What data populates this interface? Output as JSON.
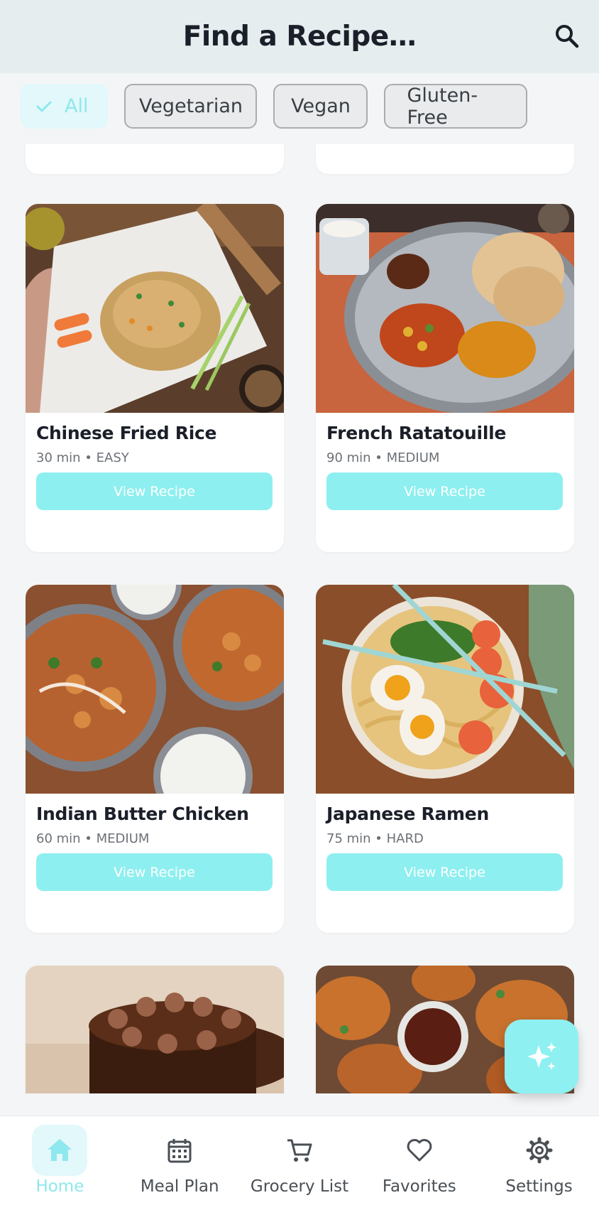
{
  "header": {
    "title": "Find a Recipe…"
  },
  "filters": [
    {
      "label": "All",
      "active": true
    },
    {
      "label": "Vegetarian",
      "active": false
    },
    {
      "label": "Vegan",
      "active": false
    },
    {
      "label": "Gluten-Free",
      "active": false
    }
  ],
  "recipes": [
    {
      "title": "Chinese Fried Rice",
      "meta": "30 min • EASY",
      "button": "View Recipe",
      "image": "fried-rice-image"
    },
    {
      "title": "French Ratatouille",
      "meta": "90 min • MEDIUM",
      "button": "View Recipe",
      "image": "thali-plate-image"
    },
    {
      "title": "Indian Butter Chicken",
      "meta": "60 min • MEDIUM",
      "button": "View Recipe",
      "image": "butter-chicken-image"
    },
    {
      "title": "Japanese Ramen",
      "meta": "75 min • HARD",
      "button": "View Recipe",
      "image": "ramen-image"
    }
  ],
  "nav": [
    {
      "label": "Home",
      "icon": "home-icon",
      "active": true
    },
    {
      "label": "Meal Plan",
      "icon": "calendar-icon",
      "active": false
    },
    {
      "label": "Grocery List",
      "icon": "cart-icon",
      "active": false
    },
    {
      "label": "Favorites",
      "icon": "heart-icon",
      "active": false
    },
    {
      "label": "Settings",
      "icon": "gear-icon",
      "active": false
    }
  ],
  "colors": {
    "accent": "#8eeff0",
    "accent_text": "#8ee8ee",
    "header_bg": "#e6edef",
    "page_bg": "#f3f5f6"
  }
}
